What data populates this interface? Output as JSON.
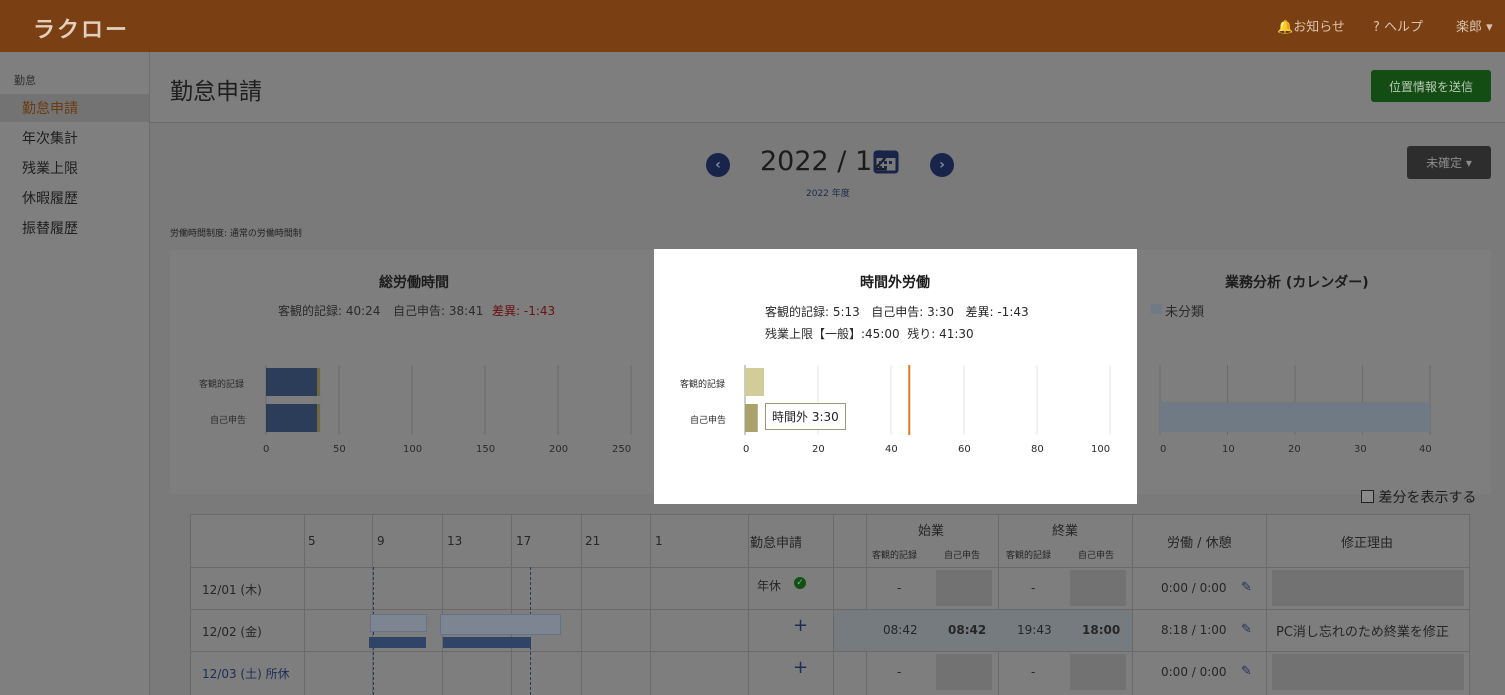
{
  "header": {
    "logo": "ラクロー",
    "notice": "お知らせ",
    "help": "ヘルプ",
    "user": "楽郎"
  },
  "sidebar": {
    "section": "勤怠",
    "items": [
      {
        "label": "勤怠申請"
      },
      {
        "label": "年次集計"
      },
      {
        "label": "残業上限"
      },
      {
        "label": "休暇履歴"
      },
      {
        "label": "振替履歴"
      }
    ]
  },
  "page": {
    "title": "勤怠申請",
    "send_location": "位置情報を送信",
    "month": "2022 / 12",
    "fiscal_year": "2022 年度",
    "status_dropdown": "未確定",
    "work_regime": "労働時間制度: 通常の労働時間制"
  },
  "total_panel": {
    "title": "総労働時間",
    "objective": "客観的記録: 40:24",
    "self": "自己申告: 38:41",
    "diff": "差異: -1:43",
    "row_labels": [
      "客観的記録",
      "自己申告"
    ],
    "xticks": [
      "0",
      "50",
      "100",
      "150",
      "200",
      "250"
    ]
  },
  "overtime_modal": {
    "title": "時間外労働",
    "line1": "客観的記録: 5:13   自己申告: 3:30   差異: -1:43",
    "line2": "残業上限【一般】:45:00  残り: 41:30",
    "row_labels": [
      "客観的記録",
      "自己申告"
    ],
    "xticks": [
      "0",
      "20",
      "40",
      "60",
      "80",
      "100"
    ],
    "tooltip": "時間外 3:30"
  },
  "analysis_panel": {
    "title": "業務分析 (カレンダー)",
    "legend": "未分類",
    "xticks": [
      "0",
      "10",
      "20",
      "30",
      "40"
    ]
  },
  "show_diff": "差分を表示する",
  "table": {
    "hours": [
      "5",
      "9",
      "13",
      "17",
      "21",
      "1"
    ],
    "col_request": "勤怠申請",
    "col_start": "始業",
    "col_end": "終業",
    "sub_obj": "客観的記録",
    "sub_self": "自己申告",
    "col_work": "労働 / 休憩",
    "col_reason": "修正理由",
    "rows": [
      {
        "date": "12/01 (木)",
        "request": "年休",
        "start_obj": "-",
        "start_self": "",
        "end_obj": "-",
        "end_self": "",
        "work": "0:00 / 0:00",
        "reason": ""
      },
      {
        "date": "12/02 (金)",
        "request": "+",
        "start_obj": "08:42",
        "start_self": "08:42",
        "end_obj": "19:43",
        "end_self": "18:00",
        "work": "8:18 / 1:00",
        "reason": "PC消し忘れのため終業を修正"
      },
      {
        "date": "12/03 (土)  所休",
        "request": "+",
        "start_obj": "-",
        "start_self": "",
        "end_obj": "-",
        "end_self": "",
        "work": "0:00 / 0:00",
        "reason": ""
      }
    ]
  },
  "chart_data": [
    {
      "type": "bar",
      "title": "総労働時間",
      "orientation": "horizontal",
      "categories": [
        "客観的記録",
        "自己申告"
      ],
      "series": [
        {
          "values": [
            35,
            35
          ]
        },
        {
          "values": [
            5.2,
            3.5
          ]
        }
      ],
      "xlim": [
        0,
        250
      ]
    },
    {
      "type": "bar",
      "title": "時間外労働",
      "orientation": "horizontal",
      "categories": [
        "客観的記録",
        "自己申告"
      ],
      "values": [
        5.2,
        3.5
      ],
      "reference_line": 45,
      "xlim": [
        0,
        100
      ]
    },
    {
      "type": "bar",
      "title": "業務分析 (カレンダー)",
      "orientation": "horizontal",
      "series": [
        {
          "name": "未分類",
          "values": [
            40.4
          ]
        }
      ],
      "xlim": [
        0,
        40
      ]
    }
  ],
  "colors": {
    "accent_orange": "#e07b22",
    "primary_green": "#2a9a2a",
    "bar_blue": "#3d5f8c",
    "overtime_olive": "#a9a26a"
  }
}
